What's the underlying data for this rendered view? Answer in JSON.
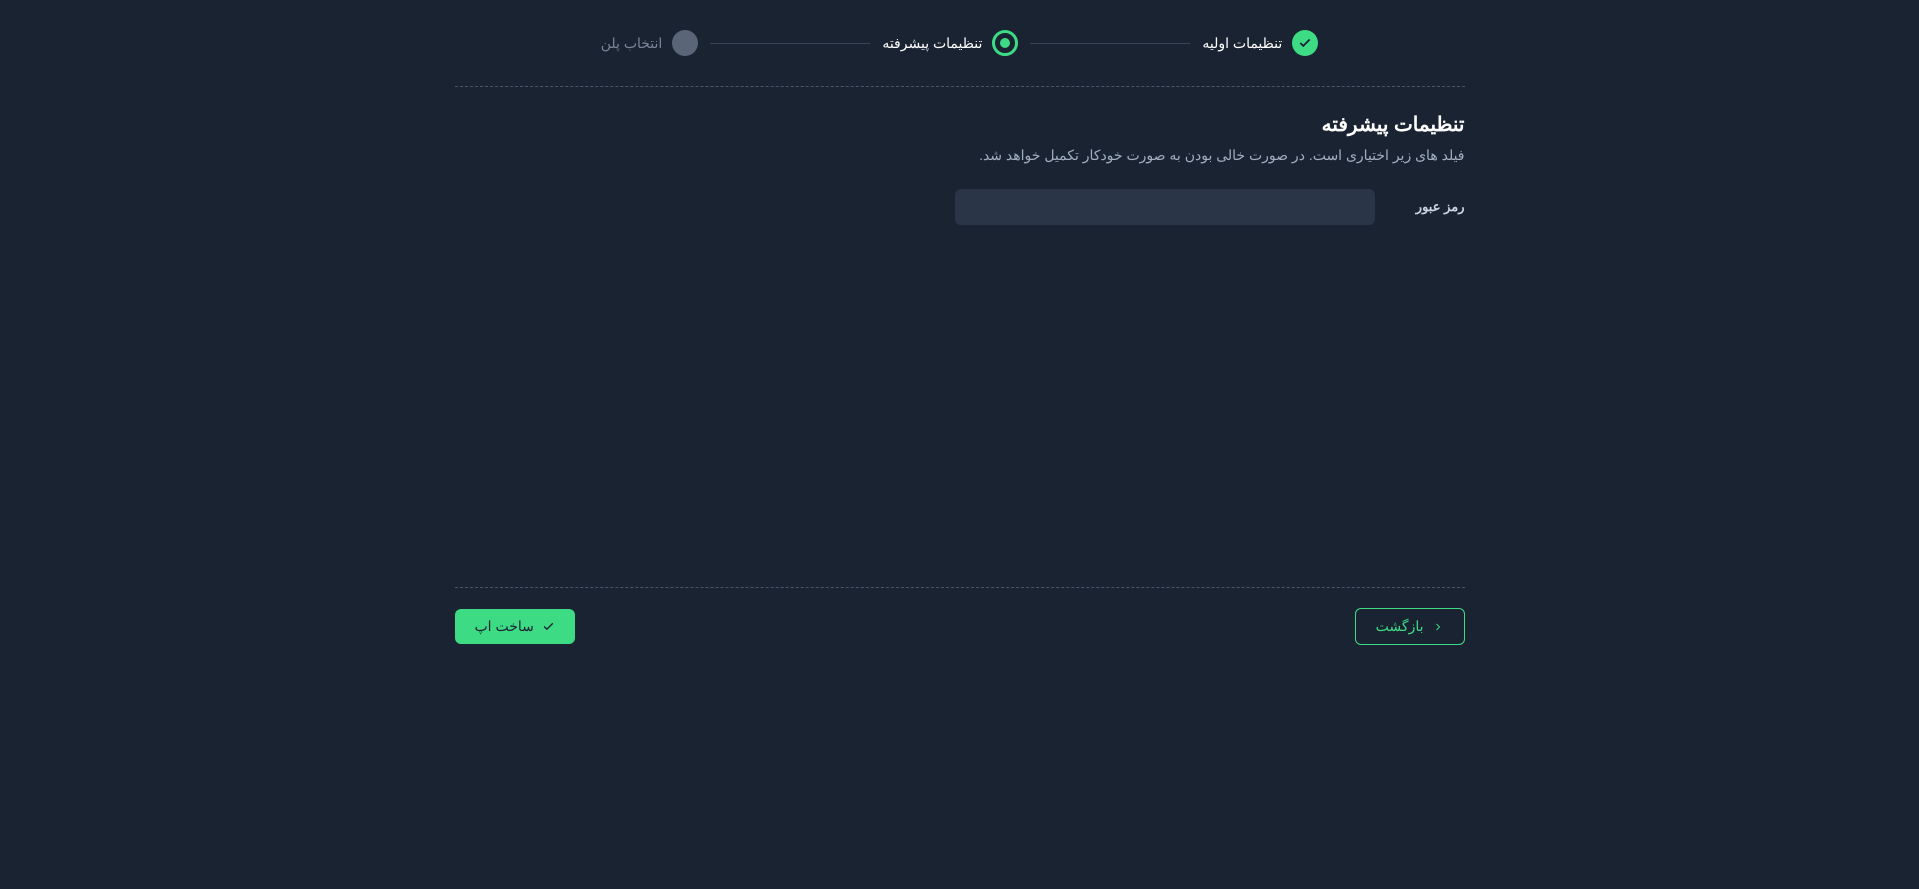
{
  "stepper": {
    "steps": [
      {
        "label": "تنظیمات اولیه",
        "state": "completed"
      },
      {
        "label": "تنظیمات پیشرفته",
        "state": "current"
      },
      {
        "label": "انتخاب پلن",
        "state": "pending"
      }
    ]
  },
  "content": {
    "title": "تنظیمات پیشرفته",
    "subtitle": "فیلد های زیر اختیاری است. در صورت خالی بودن به صورت خودکار تکمیل خواهد شد.",
    "fields": {
      "password": {
        "label": "رمز عبور",
        "value": ""
      }
    }
  },
  "footer": {
    "back_label": "بازگشت",
    "submit_label": "ساخت اپ"
  },
  "colors": {
    "accent": "#3ddc84",
    "background": "#1a2332",
    "input_bg": "#2a3548"
  }
}
